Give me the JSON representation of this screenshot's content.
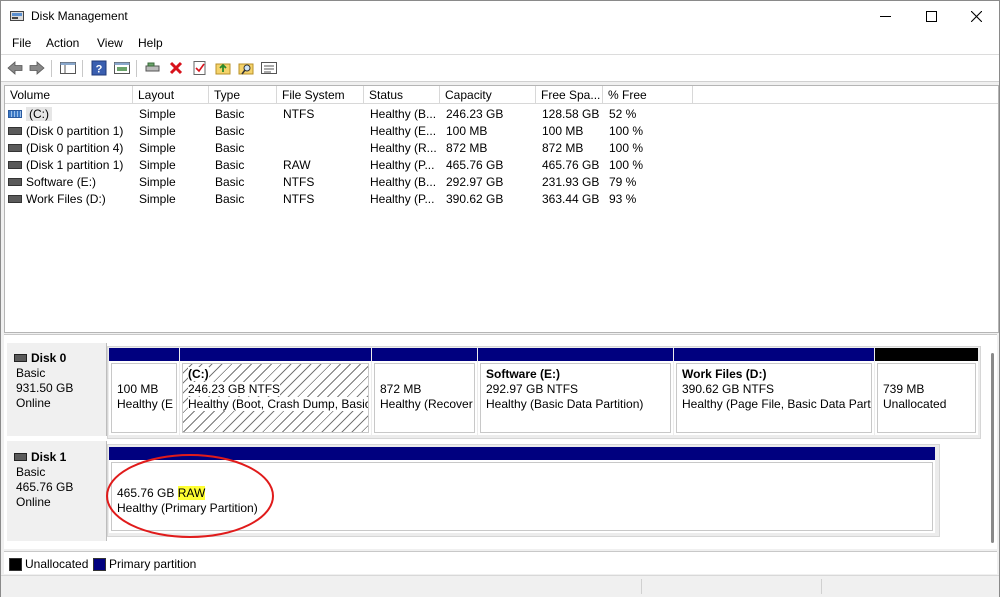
{
  "window": {
    "title": "Disk Management"
  },
  "menu": [
    "File",
    "Action",
    "View",
    "Help"
  ],
  "toolbar": [
    "back-icon",
    "forward-icon",
    "console-tree-icon",
    "help-icon",
    "properties-view-icon",
    "connect-icon",
    "delete-icon",
    "check-icon",
    "up-folder-icon",
    "search-folder-icon",
    "details-icon"
  ],
  "table": {
    "columns": [
      "Volume",
      "Layout",
      "Type",
      "File System",
      "Status",
      "Capacity",
      "Free Spa...",
      "% Free"
    ],
    "rows": [
      {
        "volume": "(C:)",
        "layout": "Simple",
        "type": "Basic",
        "fs": "NTFS",
        "status": "Healthy (B...",
        "capacity": "246.23 GB",
        "free": "128.58 GB",
        "pct": "52 %"
      },
      {
        "volume": "(Disk 0 partition 1)",
        "layout": "Simple",
        "type": "Basic",
        "fs": "",
        "status": "Healthy (E...",
        "capacity": "100 MB",
        "free": "100 MB",
        "pct": "100 %"
      },
      {
        "volume": "(Disk 0 partition 4)",
        "layout": "Simple",
        "type": "Basic",
        "fs": "",
        "status": "Healthy (R...",
        "capacity": "872 MB",
        "free": "872 MB",
        "pct": "100 %"
      },
      {
        "volume": "(Disk 1 partition 1)",
        "layout": "Simple",
        "type": "Basic",
        "fs": "RAW",
        "status": "Healthy (P...",
        "capacity": "465.76 GB",
        "free": "465.76 GB",
        "pct": "100 %"
      },
      {
        "volume": "Software (E:)",
        "layout": "Simple",
        "type": "Basic",
        "fs": "NTFS",
        "status": "Healthy (B...",
        "capacity": "292.97 GB",
        "free": "231.93 GB",
        "pct": "79 %"
      },
      {
        "volume": "Work Files (D:)",
        "layout": "Simple",
        "type": "Basic",
        "fs": "NTFS",
        "status": "Healthy (P...",
        "capacity": "390.62 GB",
        "free": "363.44 GB",
        "pct": "93 %"
      }
    ]
  },
  "disks": [
    {
      "name": "Disk 0",
      "type": "Basic",
      "size": "931.50 GB",
      "status": "Online",
      "partitions": [
        {
          "label": "",
          "size": "100 MB",
          "status": "Healthy (E"
        },
        {
          "label": "(C:)",
          "size": "246.23 GB NTFS",
          "status": "Healthy (Boot, Crash Dump, Basic"
        },
        {
          "label": "",
          "size": "872 MB",
          "status": "Healthy (Recover"
        },
        {
          "label": "Software  (E:)",
          "size": "292.97 GB NTFS",
          "status": "Healthy (Basic Data Partition)"
        },
        {
          "label": "Work Files  (D:)",
          "size": "390.62 GB NTFS",
          "status": "Healthy (Page File, Basic Data Partit"
        },
        {
          "label": "",
          "size": "739 MB",
          "status": "Unallocated"
        }
      ]
    },
    {
      "name": "Disk 1",
      "type": "Basic",
      "size": "465.76 GB",
      "status": "Online",
      "partitions": [
        {
          "size_prefix": "465.76 GB ",
          "fs": "RAW",
          "status": "Healthy (Primary Partition)"
        }
      ]
    }
  ],
  "legend": [
    {
      "label": "Unallocated",
      "color": "#000000"
    },
    {
      "label": "Primary partition",
      "color": "#00007f"
    }
  ],
  "colors": {
    "primary": "#00007f",
    "unallocated": "#000000",
    "annotation": "#e01b1b",
    "highlight": "#ffff33"
  }
}
